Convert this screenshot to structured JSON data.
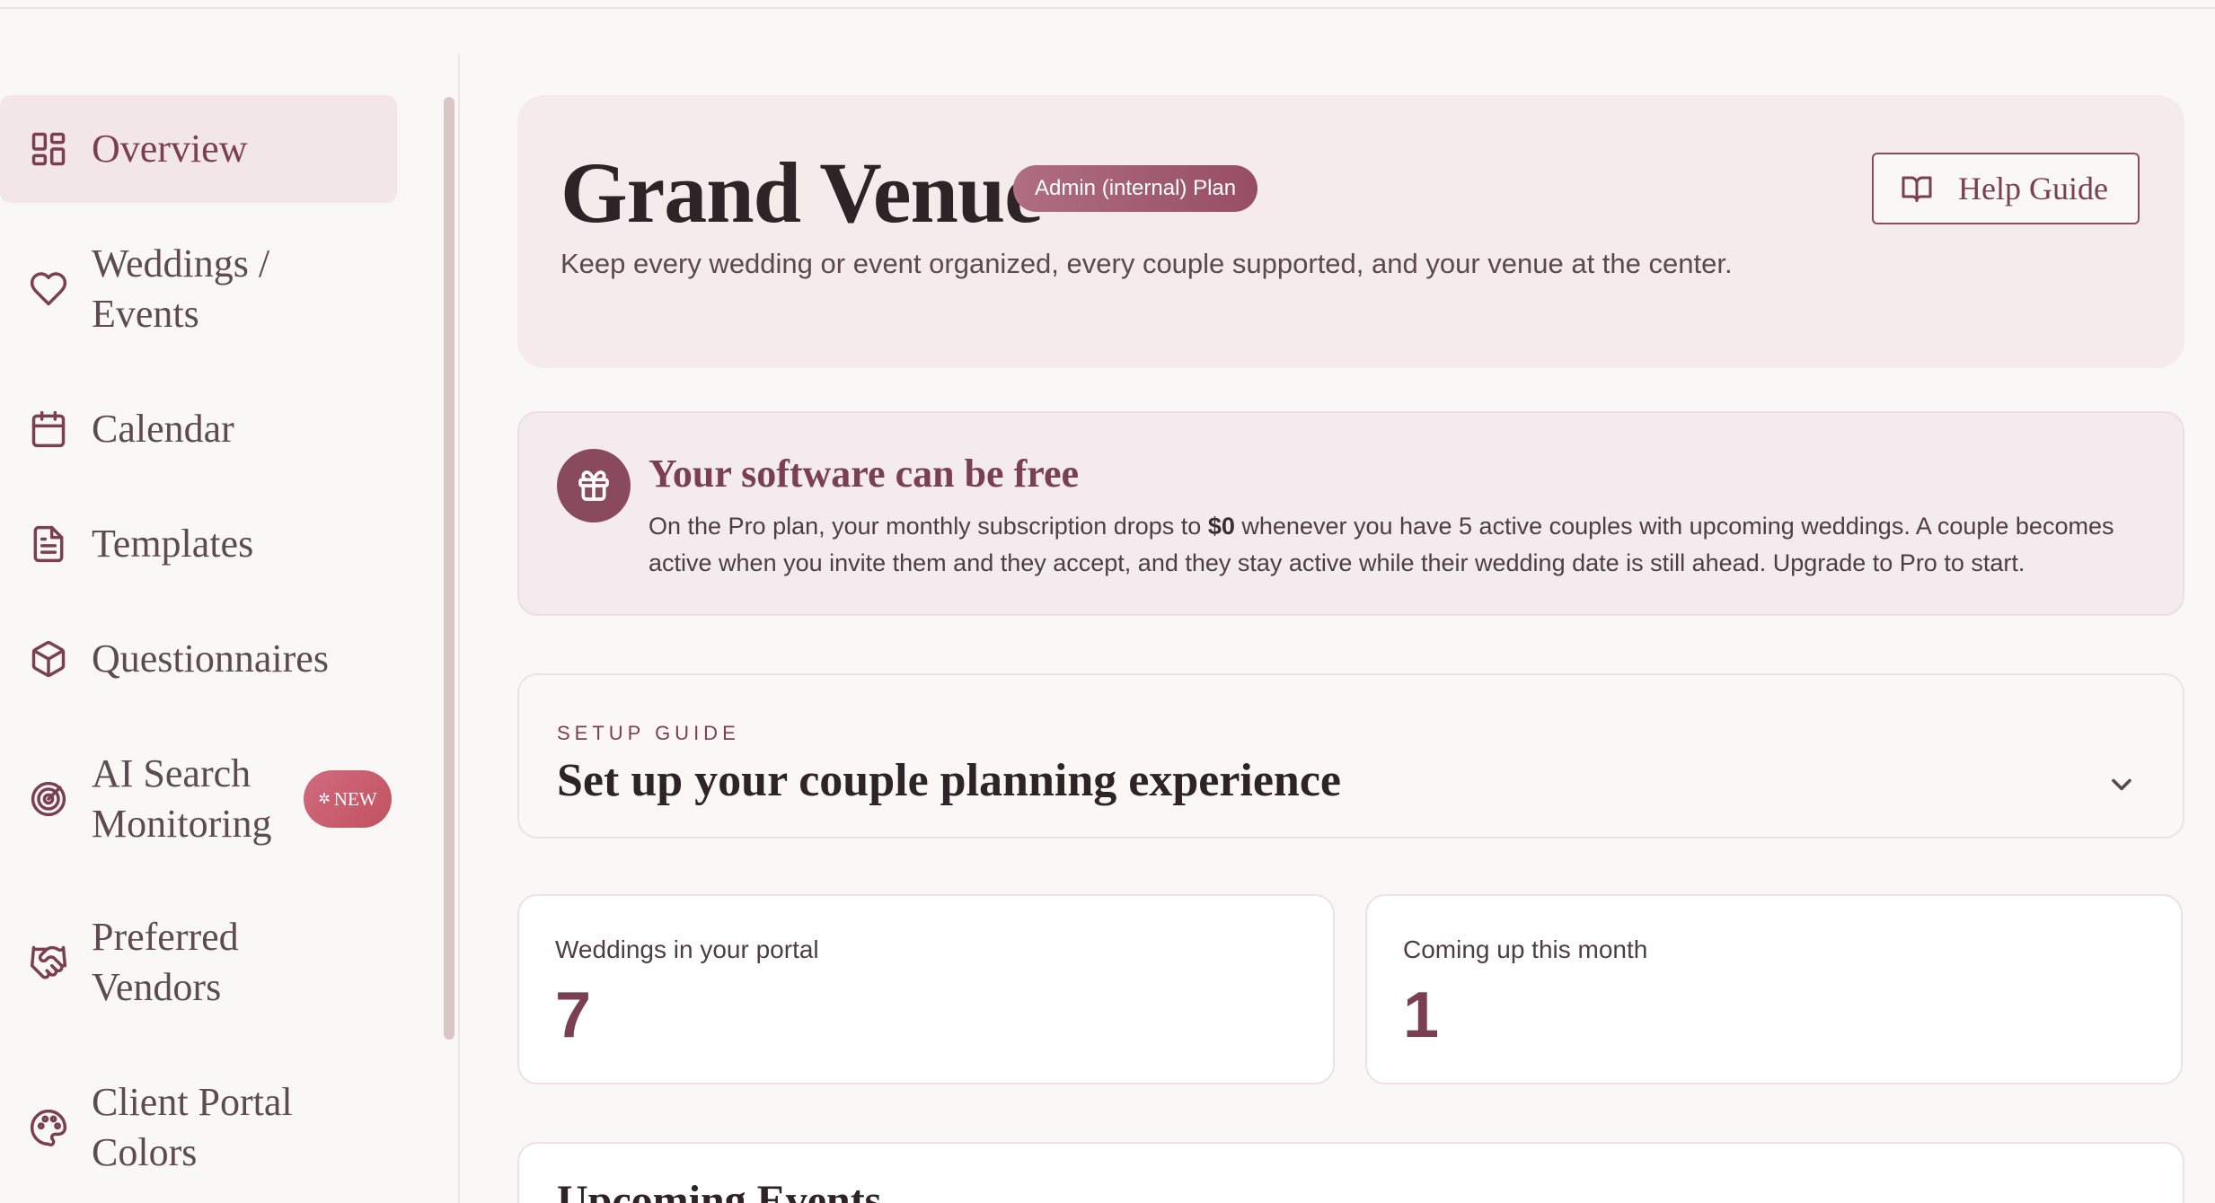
{
  "sidebar": {
    "items": [
      {
        "label": "Overview",
        "icon": "dashboard-icon"
      },
      {
        "label": "Weddings /\nEvents",
        "icon": "heart-icon"
      },
      {
        "label": "Calendar",
        "icon": "calendar-icon"
      },
      {
        "label": "Templates",
        "icon": "document-icon"
      },
      {
        "label": "Questionnaires",
        "icon": "cube-icon"
      },
      {
        "label": "AI Search\nMonitoring",
        "icon": "target-icon",
        "badge": "NEW"
      },
      {
        "label": "Preferred\nVendors",
        "icon": "handshake-icon"
      },
      {
        "label": "Client Portal\nColors",
        "icon": "palette-icon"
      }
    ]
  },
  "hero": {
    "title": "Grand Venue",
    "plan_badge": "Admin (internal) Plan",
    "subtitle": "Keep every wedding or event organized, every couple supported, and your venue at the center.",
    "help_label": "Help Guide"
  },
  "free_banner": {
    "title": "Your software can be free",
    "body_before": "On the Pro plan, your monthly subscription drops to ",
    "body_bold": "$0",
    "body_after": " whenever you have 5 active couples with upcoming weddings. A couple becomes active when you invite them and they accept, and they stay active while their wedding date is still ahead. Upgrade to Pro to start."
  },
  "setup_guide": {
    "eyebrow": "SETUP GUIDE",
    "title": "Set up your couple planning experience"
  },
  "stats": [
    {
      "label": "Weddings in your portal",
      "value": "7"
    },
    {
      "label": "Coming up this month",
      "value": "1"
    }
  ],
  "upcoming": {
    "title": "Upcoming Events"
  },
  "colors": {
    "accent": "#7b3f53",
    "hero_bg": "#f5eaec",
    "badge_gradient": "#c2525f"
  }
}
